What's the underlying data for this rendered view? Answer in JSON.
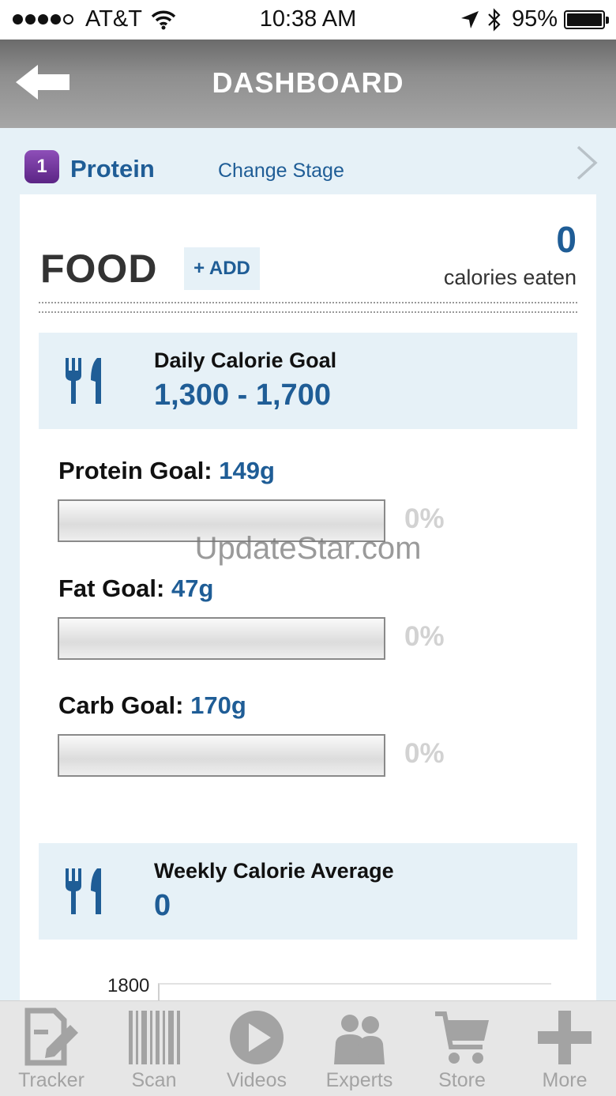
{
  "status_bar": {
    "carrier": "AT&T",
    "time": "10:38 AM",
    "battery": "95%"
  },
  "header": {
    "title": "DASHBOARD"
  },
  "stage": {
    "number": "1",
    "name": "Protein",
    "change_label": "Change Stage"
  },
  "food": {
    "title": "FOOD",
    "add_label": "+ ADD",
    "calories_value": "0",
    "calories_label": "calories eaten"
  },
  "daily_goal": {
    "label": "Daily Calorie Goal",
    "value": "1,300 - 1,700"
  },
  "macros": [
    {
      "label": "Protein Goal:",
      "value": "149g",
      "percent_text": "0%",
      "progress": 0
    },
    {
      "label": "Fat Goal:",
      "value": "47g",
      "percent_text": "0%",
      "progress": 0
    },
    {
      "label": "Carb Goal:",
      "value": "170g",
      "percent_text": "0%",
      "progress": 0
    }
  ],
  "watermark": "UpdateStar.com",
  "weekly": {
    "label": "Weekly Calorie Average",
    "value": "0"
  },
  "chart": {
    "top_tick": "1800"
  },
  "tabs": [
    {
      "label": "Tracker",
      "icon": "tracker-icon"
    },
    {
      "label": "Scan",
      "icon": "barcode-icon"
    },
    {
      "label": "Videos",
      "icon": "play-icon"
    },
    {
      "label": "Experts",
      "icon": "experts-icon"
    },
    {
      "label": "Store",
      "icon": "cart-icon"
    },
    {
      "label": "More",
      "icon": "plus-icon"
    }
  ],
  "colors": {
    "accent": "#1f5d96",
    "stage_badge": "#6a2f95",
    "panel": "#e6f1f7"
  }
}
